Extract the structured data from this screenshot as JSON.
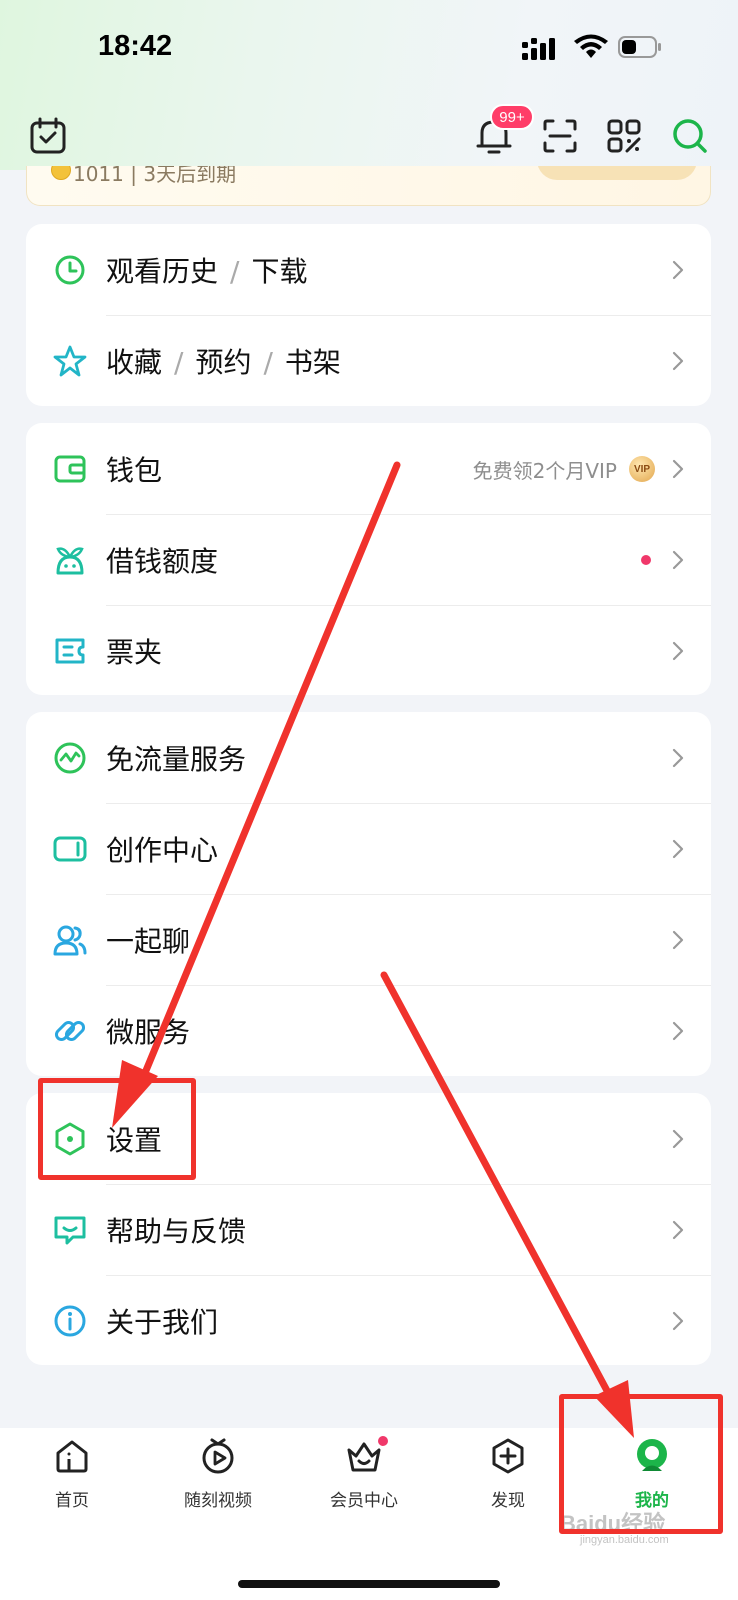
{
  "status_bar": {
    "time": "18:42"
  },
  "header": {
    "notification_badge": "99+",
    "icons": [
      "calendar-check-icon",
      "bell-icon",
      "scan-icon",
      "qr-code-icon",
      "search-icon"
    ]
  },
  "vip_card": {
    "text": "1011 | 3天后到期"
  },
  "groups": [
    {
      "items": [
        {
          "label_parts": [
            "观看历史",
            "下载"
          ],
          "icon": "clock-icon"
        },
        {
          "label_parts": [
            "收藏",
            "预约",
            "书架"
          ],
          "icon": "star-icon"
        }
      ]
    },
    {
      "items": [
        {
          "label": "钱包",
          "icon": "wallet-icon",
          "extra": "免费领2个月VIP",
          "badge": "VIP"
        },
        {
          "label": "借钱额度",
          "icon": "sprout-icon",
          "red_dot": true
        },
        {
          "label": "票夹",
          "icon": "ticket-icon"
        }
      ]
    },
    {
      "items": [
        {
          "label": "免流量服务",
          "icon": "pulse-icon"
        },
        {
          "label": "创作中心",
          "icon": "video-camera-icon"
        },
        {
          "label": "一起聊",
          "icon": "people-icon"
        },
        {
          "label": "微服务",
          "icon": "link-icon"
        }
      ]
    },
    {
      "items": [
        {
          "label": "设置",
          "icon": "settings-hexagon-icon"
        },
        {
          "label": "帮助与反馈",
          "icon": "help-chat-icon"
        },
        {
          "label": "关于我们",
          "icon": "info-icon"
        }
      ]
    }
  ],
  "bottom_nav": [
    {
      "label": "首页",
      "icon": "home-icon",
      "active": false
    },
    {
      "label": "随刻视频",
      "icon": "play-circle-icon",
      "active": false
    },
    {
      "label": "会员中心",
      "icon": "crown-basket-icon",
      "active": false,
      "dot": true
    },
    {
      "label": "发现",
      "icon": "plus-hexagon-icon",
      "active": false
    },
    {
      "label": "我的",
      "icon": "profile-avatar-icon",
      "active": true
    }
  ],
  "watermark": {
    "text": "Baidu经验",
    "sub": "jingyan.baidu.com"
  },
  "colors": {
    "accent_green": "#1cb54a",
    "annotation_red": "#f0322c",
    "badge_red": "#ff3d68"
  }
}
